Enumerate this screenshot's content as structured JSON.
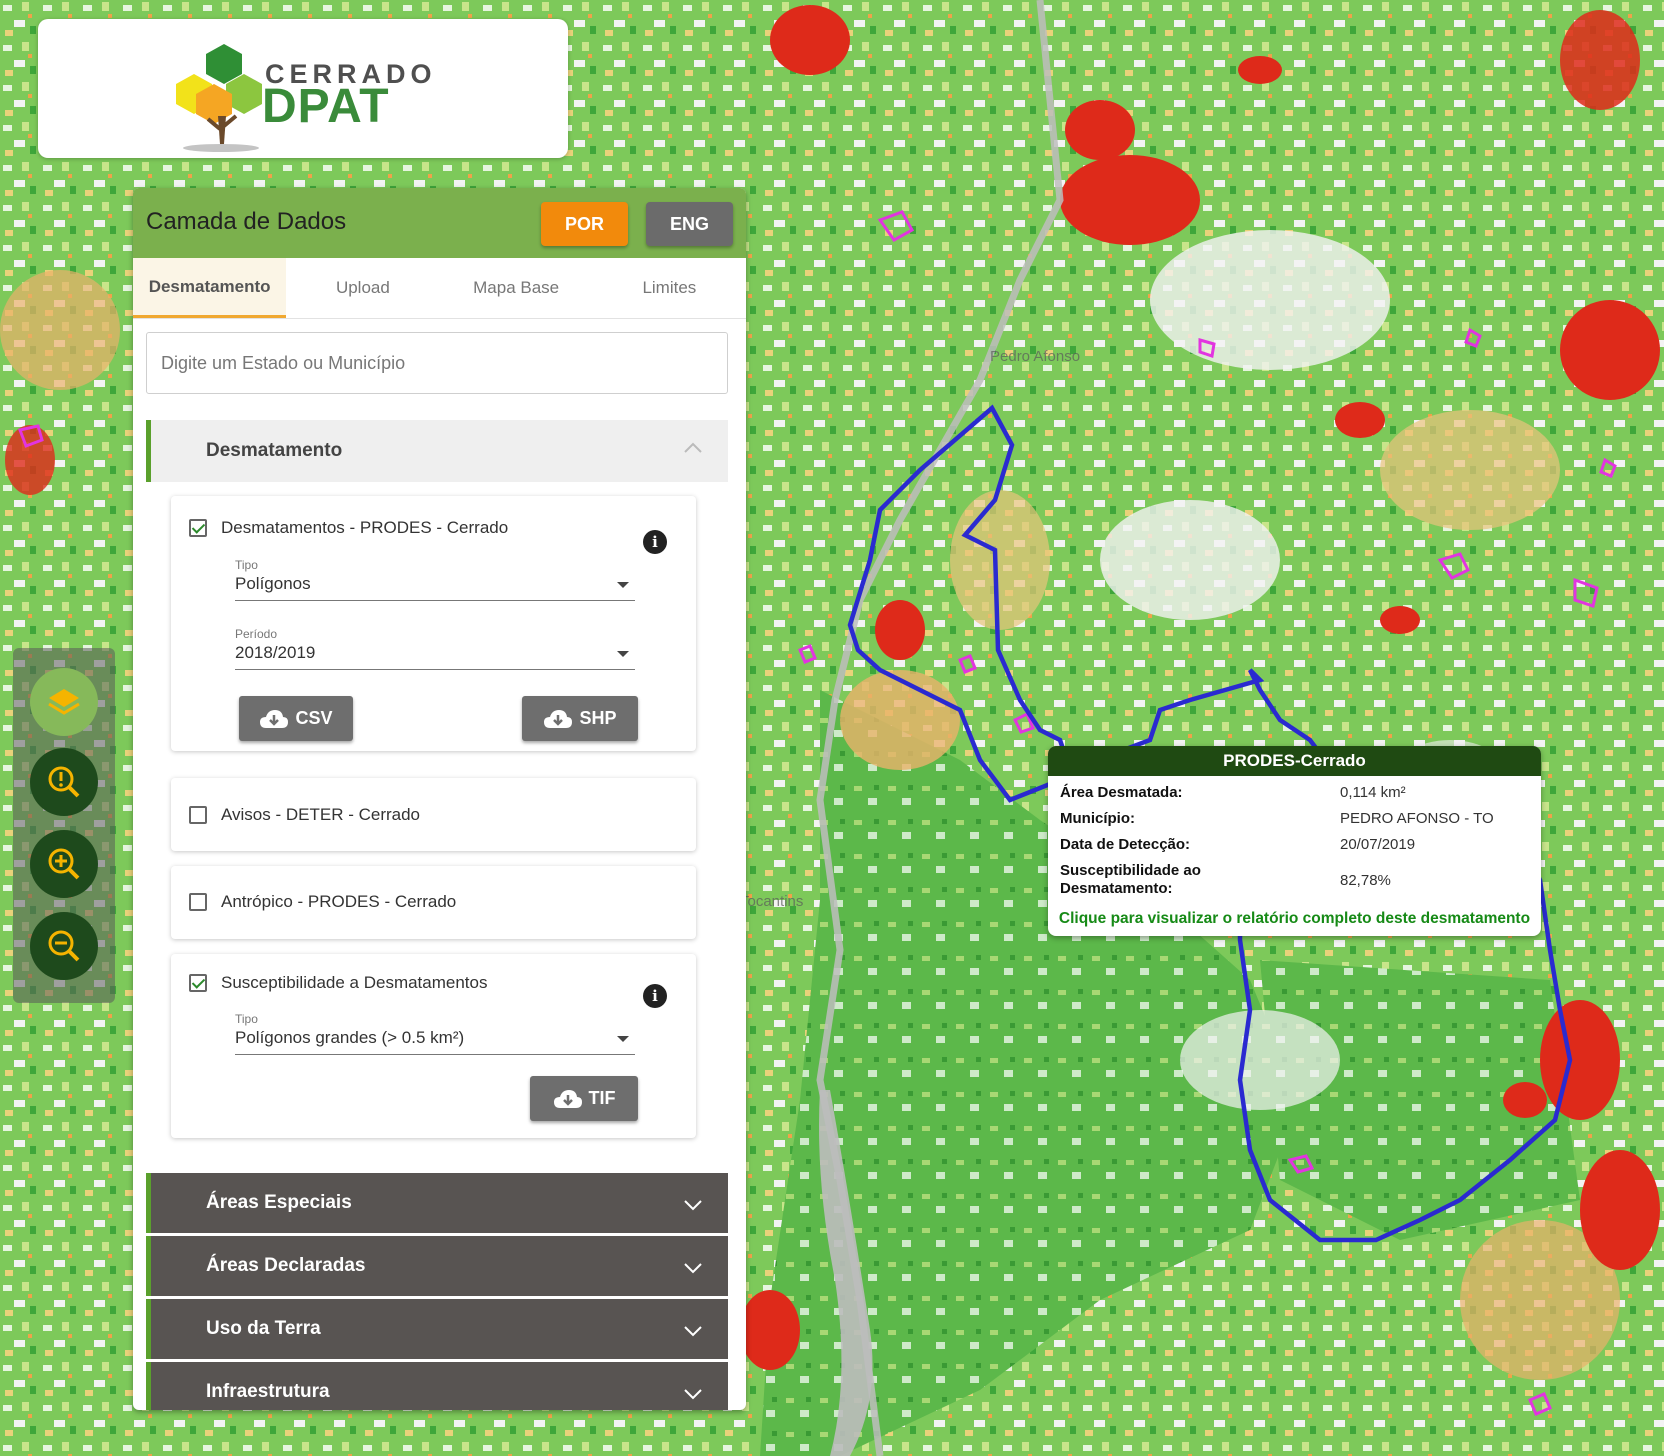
{
  "logo": {
    "line1": "CERRADO",
    "line2": "DPAT"
  },
  "panel": {
    "title": "Camada de Dados",
    "lang_por": "POR",
    "lang_eng": "ENG",
    "tabs": [
      "Desmatamento",
      "Upload",
      "Mapa Base",
      "Limites"
    ],
    "search_placeholder": "Digite um Estado ou Município",
    "open_section": "Desmatamento",
    "layers": [
      {
        "label": "Desmatamentos - PRODES - Cerrado",
        "checked": true,
        "tipo_label": "Tipo",
        "tipo_value": "Polígonos",
        "periodo_label": "Período",
        "periodo_value": "2018/2019",
        "btn_csv": "CSV",
        "btn_shp": "SHP"
      },
      {
        "label": "Avisos - DETER - Cerrado",
        "checked": false
      },
      {
        "label": "Antrópico - PRODES - Cerrado",
        "checked": false
      },
      {
        "label": "Susceptibilidade a Desmatamentos",
        "checked": true,
        "tipo_label": "Tipo",
        "tipo_value": "Polígonos grandes (> 0.5 km²)",
        "btn_tif": "TIF"
      }
    ],
    "collapsed_sections": [
      "Áreas Especiais",
      "Áreas Declaradas",
      "Uso da Terra",
      "Infraestrutura"
    ]
  },
  "popup": {
    "title": "PRODES-Cerrado",
    "rows": [
      {
        "key": "Área Desmatada:",
        "value": "0,114 km²"
      },
      {
        "key": "Município:",
        "value": "PEDRO AFONSO - TO"
      },
      {
        "key": "Data de Detecção:",
        "value": "20/07/2019"
      },
      {
        "key": "Susceptibilidade ao Desmatamento:",
        "value": "82,78%"
      }
    ],
    "link": "Clique para visualizar o relatório completo deste desmatamento"
  },
  "map_labels": [
    "Pedro Afonso",
    "Tocantins"
  ],
  "colors": {
    "header_green": "#7bb04d",
    "por_orange": "#f28a0c",
    "eng_gray": "#6b6b6b",
    "boundary_blue": "#2a2ad0",
    "popup_header": "#1f4a12",
    "link_green": "#168a16"
  }
}
